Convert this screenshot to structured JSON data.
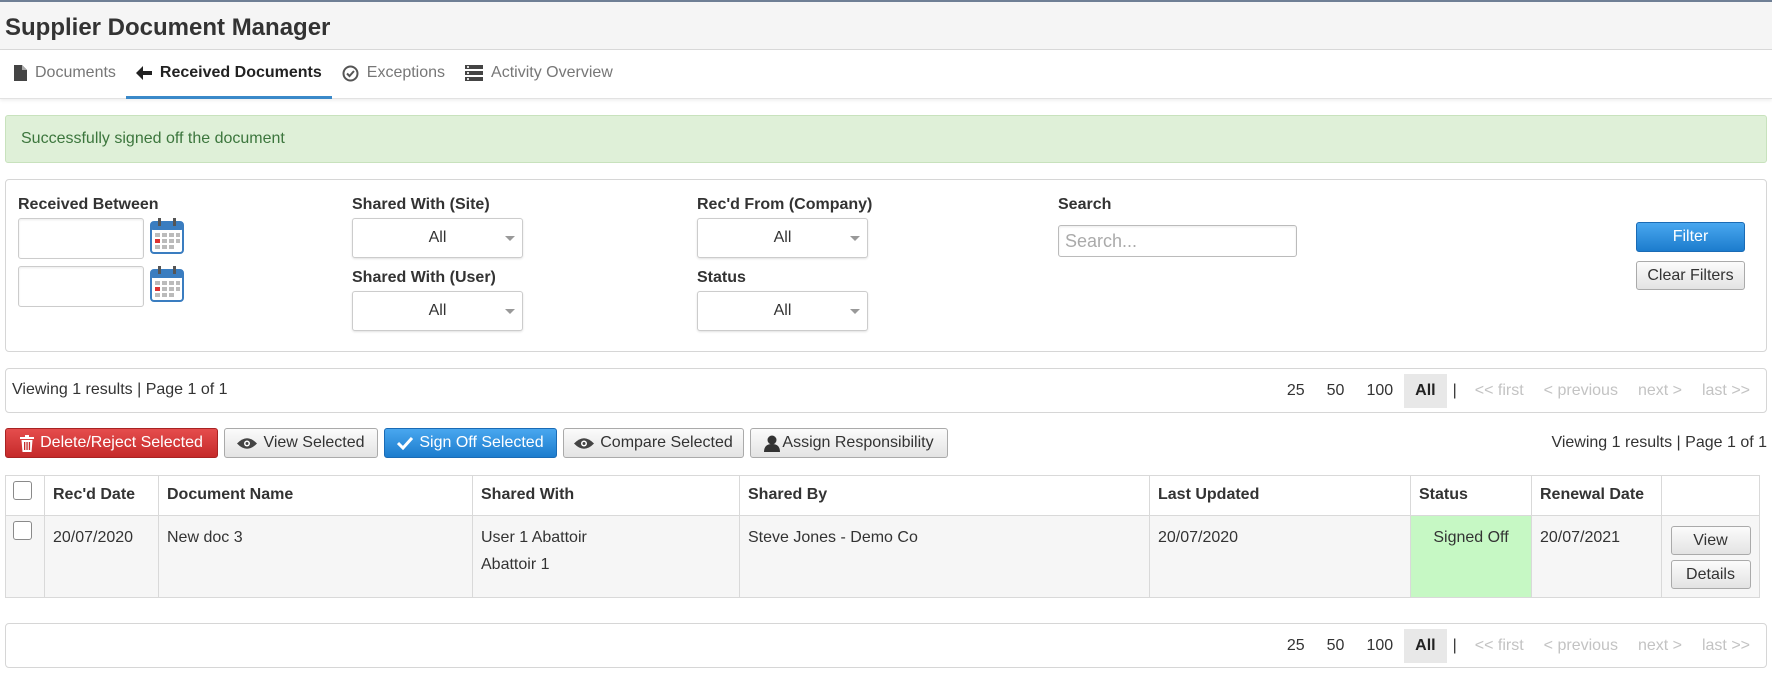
{
  "app": {
    "title": "Supplier Document Manager"
  },
  "tabs": [
    {
      "label": "Documents",
      "icon": "document-icon",
      "active": false
    },
    {
      "label": "Received Documents",
      "icon": "arrow-left-icon",
      "active": true
    },
    {
      "label": "Exceptions",
      "icon": "check-circle-icon",
      "active": false
    },
    {
      "label": "Activity Overview",
      "icon": "list-icon",
      "active": false
    }
  ],
  "alert": {
    "message": "Successfully signed off the document"
  },
  "filters": {
    "received_between_label": "Received Between",
    "shared_site_label": "Shared With (Site)",
    "shared_site_value": "All",
    "shared_user_label": "Shared With (User)",
    "shared_user_value": "All",
    "company_label": "Rec'd From (Company)",
    "company_value": "All",
    "status_label": "Status",
    "status_value": "All",
    "search_label": "Search",
    "search_placeholder": "Search...",
    "filter_button": "Filter",
    "clear_button": "Clear Filters"
  },
  "paging": {
    "info": "Viewing 1 results | Page 1 of 1",
    "sizes": [
      "25",
      "50",
      "100",
      "All"
    ],
    "selected_size": "All",
    "separator": "|",
    "first": "<< first",
    "previous": "< previous",
    "next": "next >",
    "last": "last >>"
  },
  "actions": {
    "delete_reject": "Delete/Reject Selected",
    "view_selected": "View Selected",
    "sign_off": "Sign Off Selected",
    "compare": "Compare Selected",
    "assign": "Assign Responsibility",
    "info": "Viewing 1 results | Page 1 of 1"
  },
  "table": {
    "columns": [
      "Rec'd Date",
      "Document Name",
      "Shared With",
      "Shared By",
      "Last Updated",
      "Status",
      "Renewal Date"
    ],
    "rows": [
      {
        "recd_date": "20/07/2020",
        "document_name": "New doc 3",
        "shared_with_user": "User 1 Abattoir",
        "shared_with_site": "Abattoir 1",
        "shared_by": "Steve Jones - Demo Co",
        "last_updated": "20/07/2020",
        "status": "Signed Off",
        "renewal_date": "20/07/2021",
        "view_button": "View",
        "details_button": "Details"
      }
    ]
  },
  "colors": {
    "accent_blue": "#1c7ccd",
    "danger_red": "#c52a2a",
    "success_bg": "#dff0d8",
    "status_signed_off": "#c6f8c4"
  }
}
